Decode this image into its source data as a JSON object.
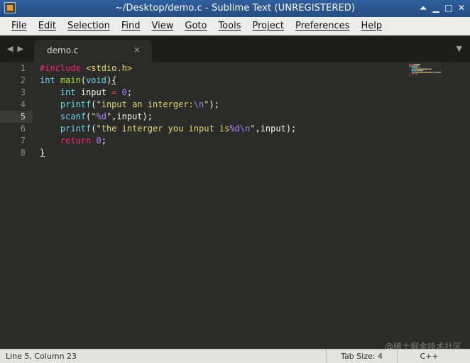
{
  "window": {
    "title": "~/Desktop/demo.c - Sublime Text (UNREGISTERED)",
    "controls": [
      "⏶",
      "▁",
      "□",
      "✕"
    ]
  },
  "menu": {
    "items": [
      "File",
      "Edit",
      "Selection",
      "Find",
      "View",
      "Goto",
      "Tools",
      "Project",
      "Preferences",
      "Help"
    ]
  },
  "tabs": {
    "nav_prev": "◀",
    "nav_next": "▶",
    "active": {
      "label": "demo.c",
      "close": "×"
    },
    "dropdown": "▼"
  },
  "editor": {
    "current_line": 5,
    "line_numbers": [
      "1",
      "2",
      "3",
      "4",
      "5",
      "6",
      "7",
      "8"
    ],
    "lines": [
      [
        {
          "t": "#",
          "c": "kw"
        },
        {
          "t": "include",
          "c": "kw"
        },
        {
          "t": " <stdio.h>",
          "c": "str"
        }
      ],
      [
        {
          "t": "int",
          "c": "ty"
        },
        {
          "t": " ",
          "c": "pl"
        },
        {
          "t": "main",
          "c": "fn"
        },
        {
          "t": "(",
          "c": "pl"
        },
        {
          "t": "void",
          "c": "ty"
        },
        {
          "t": ")",
          "c": "pl"
        },
        {
          "t": "{",
          "c": "pl"
        }
      ],
      [
        {
          "t": "    ",
          "c": "pl"
        },
        {
          "t": "int",
          "c": "ty"
        },
        {
          "t": " input ",
          "c": "pl"
        },
        {
          "t": "=",
          "c": "kw"
        },
        {
          "t": " ",
          "c": "pl"
        },
        {
          "t": "0",
          "c": "num"
        },
        {
          "t": ";",
          "c": "pl"
        }
      ],
      [
        {
          "t": "    ",
          "c": "pl"
        },
        {
          "t": "printf",
          "c": "ty"
        },
        {
          "t": "(",
          "c": "pl"
        },
        {
          "t": "\"input an interger:",
          "c": "str"
        },
        {
          "t": "\\n",
          "c": "esc"
        },
        {
          "t": "\"",
          "c": "str"
        },
        {
          "t": ");",
          "c": "pl"
        }
      ],
      [
        {
          "t": "    ",
          "c": "pl"
        },
        {
          "t": "scanf",
          "c": "ty"
        },
        {
          "t": "(",
          "c": "pl"
        },
        {
          "t": "\"",
          "c": "str"
        },
        {
          "t": "%d",
          "c": "esc"
        },
        {
          "t": "\"",
          "c": "str"
        },
        {
          "t": ",input);",
          "c": "pl"
        }
      ],
      [
        {
          "t": "    ",
          "c": "pl"
        },
        {
          "t": "printf",
          "c": "ty"
        },
        {
          "t": "(",
          "c": "pl"
        },
        {
          "t": "\"the interger you input is",
          "c": "str"
        },
        {
          "t": "%d",
          "c": "esc"
        },
        {
          "t": "\\n",
          "c": "esc"
        },
        {
          "t": "\"",
          "c": "str"
        },
        {
          "t": ",input);",
          "c": "pl"
        }
      ],
      [
        {
          "t": "    ",
          "c": "pl"
        },
        {
          "t": "return",
          "c": "kw"
        },
        {
          "t": " ",
          "c": "pl"
        },
        {
          "t": "0",
          "c": "num"
        },
        {
          "t": ";",
          "c": "pl"
        }
      ],
      [
        {
          "t": "}",
          "c": "pl"
        }
      ]
    ]
  },
  "watermark": "@稀土掘金技术社区",
  "status": {
    "position": "Line 5, Column 23",
    "tab_size": "Tab Size: 4",
    "syntax": "C++"
  },
  "colors": {
    "editor_bg": "#2b2b29",
    "keyword": "#f92672",
    "type": "#66d9ef",
    "function": "#a6e22e",
    "string": "#e6db74",
    "number": "#ae81ff",
    "titlebar": "#2f5f9e"
  }
}
